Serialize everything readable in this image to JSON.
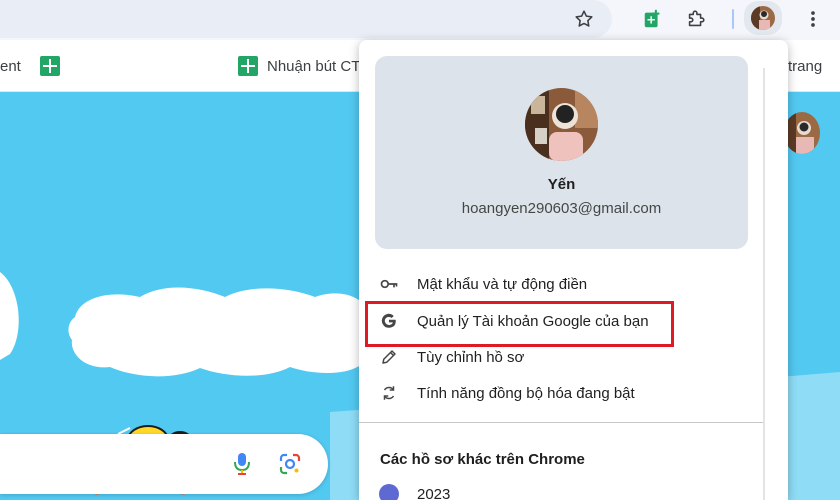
{
  "toolbar": {
    "icons": [
      "star-icon",
      "sheets-extension-icon",
      "puzzle-icon",
      "avatar",
      "more-vert-icon"
    ]
  },
  "bookmarks": {
    "items": [
      {
        "label": "ent",
        "icon": "none"
      },
      {
        "label": "",
        "icon": "google-sheets-icon"
      },
      {
        "label": "Nhuận bút CT",
        "icon": "google-sheets-icon"
      },
      {
        "label": "trang",
        "icon": "none"
      }
    ]
  },
  "profile_menu": {
    "name": "Yến",
    "email": "hoangyen290603@gmail.com",
    "items": [
      {
        "label": "Mật khẩu và tự động điền",
        "icon": "key-icon"
      },
      {
        "label": "Quản lý Tài khoản Google của bạn",
        "icon": "google-g-icon",
        "highlighted": true
      },
      {
        "label": "Tùy chỉnh hồ sơ",
        "icon": "pencil-icon"
      },
      {
        "label": "Tính năng đồng bộ hóa đang bật",
        "icon": "sync-icon"
      }
    ],
    "other_profiles_title": "Các hồ sơ khác trên Chrome",
    "other_profiles": [
      {
        "label": "2023"
      }
    ]
  },
  "colors": {
    "highlight": "#e01a22",
    "page_background": "#52c9f1",
    "card_background": "#dde3ea",
    "sheets_green": "#23a566",
    "accent_blue": "#a8c7fa"
  }
}
